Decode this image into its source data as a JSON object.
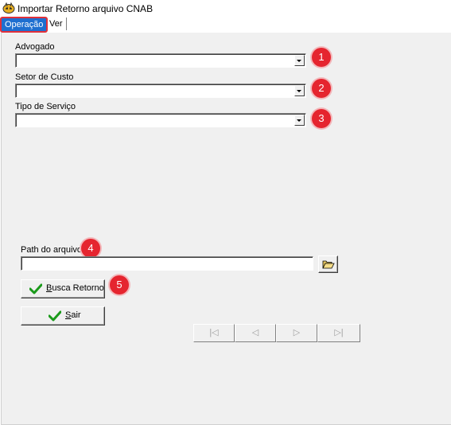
{
  "window": {
    "title": "Importar Retorno arquivo CNAB",
    "icon": "tiger-app-icon"
  },
  "menu": {
    "items": [
      {
        "label": "Operação"
      },
      {
        "label": "Ver"
      }
    ]
  },
  "form": {
    "advogado": {
      "label": "Advogado",
      "value": ""
    },
    "setor": {
      "label": "Setor de Custo",
      "value": ""
    },
    "tipo": {
      "label": "Tipo de Serviço",
      "value": ""
    },
    "path": {
      "label": "Path do arquivo",
      "value": ""
    }
  },
  "buttons": {
    "busca": {
      "underlined": "B",
      "rest": "usca Retorno"
    },
    "sair": {
      "underlined": "S",
      "rest": "air"
    }
  },
  "callouts": [
    "1",
    "2",
    "3",
    "4",
    "5"
  ],
  "navigator": {
    "first": "|◁",
    "prev": "◁",
    "next": "▷",
    "last": "▷|"
  },
  "colors": {
    "accent": "#1e6fd0",
    "callout": "#e5252f",
    "check": "#1a9a1a"
  }
}
